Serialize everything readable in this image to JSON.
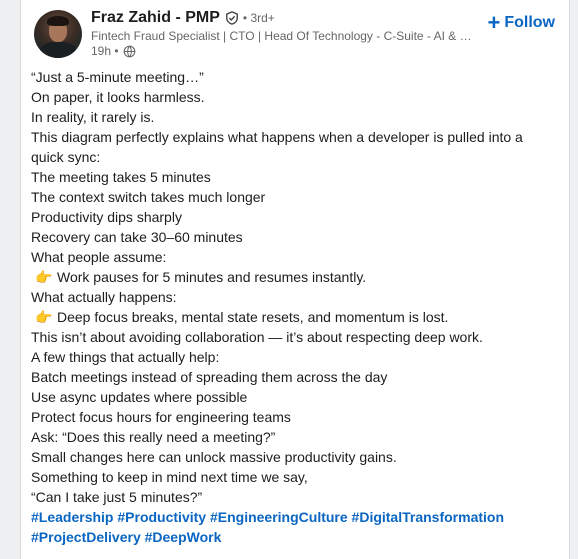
{
  "post": {
    "author": {
      "name": "Fraz Zahid - PMP",
      "degree": "• 3rd+",
      "headline": "Fintech Fraud Specialist | CTO | Head Of Technology - C-Suite - AI & Digital Transformation",
      "time": "19h •",
      "avatar_icon": "profile-photo",
      "verified_icon": "shield-check-icon",
      "visibility_icon": "globe-icon"
    },
    "follow_label": "Follow",
    "lines": [
      "“Just a 5-minute meeting…”",
      "On paper, it looks harmless.",
      " In reality, it rarely is.",
      "This diagram perfectly explains what happens when a developer is pulled into a",
      "quick sync:",
      "The meeting takes 5 minutes",
      "The context switch takes much longer",
      "Productivity dips sharply",
      "Recovery can take 30–60 minutes",
      "What people assume:",
      "Work pauses for 5 minutes and resumes instantly.",
      "What actually happens:",
      "Deep focus breaks, mental state resets, and momentum is lost.",
      "This isn’t about avoiding collaboration — it’s about respecting deep work.",
      "A few things that actually help:",
      "Batch meetings instead of spreading them across the day",
      "Use async updates where possible",
      "Protect focus hours for engineering teams",
      "Ask: “Does this really need a meeting?”",
      "Small changes here can unlock massive productivity gains.",
      "Something to keep in mind next time we say,",
      " “Can I take just 5 minutes?”"
    ],
    "pointer_emoji": "👉",
    "hashtags": [
      "#Leadership",
      "#Productivity",
      "#EngineeringCulture",
      "#DigitalTransformation",
      "#ProjectDelivery",
      "#DeepWork"
    ],
    "colors": {
      "link": "#0a66c2",
      "text": "#1d1d1d",
      "muted": "#666666"
    }
  }
}
